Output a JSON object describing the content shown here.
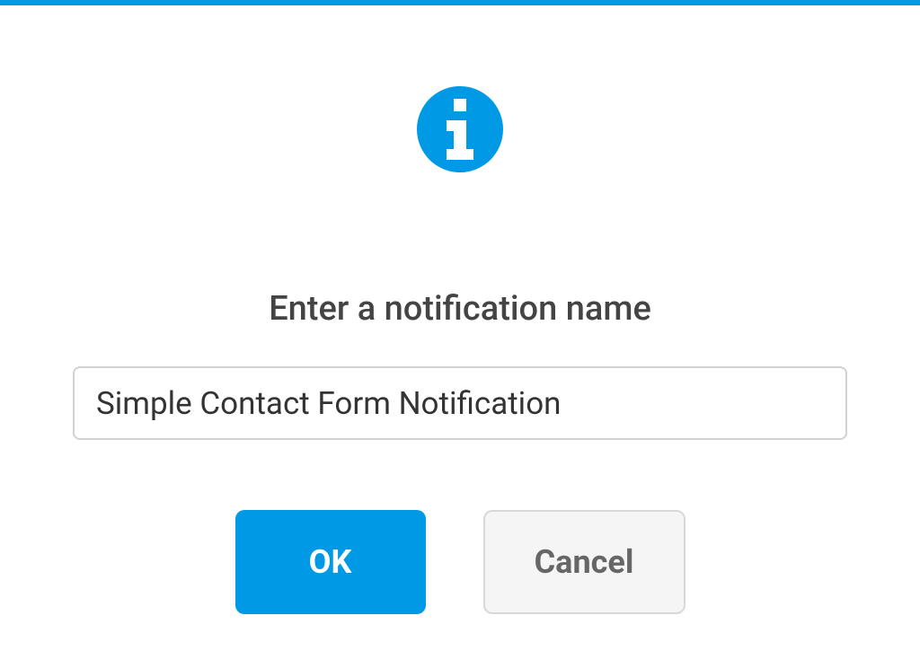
{
  "dialog": {
    "title": "Enter a notification name",
    "input_value": "Simple Contact Form Notification",
    "input_placeholder": "",
    "ok_label": "OK",
    "cancel_label": "Cancel"
  },
  "icons": {
    "info": "info-icon"
  },
  "colors": {
    "accent": "#0099e5",
    "text_primary": "#444444",
    "text_secondary": "#666666",
    "border": "#d2d2d2"
  }
}
